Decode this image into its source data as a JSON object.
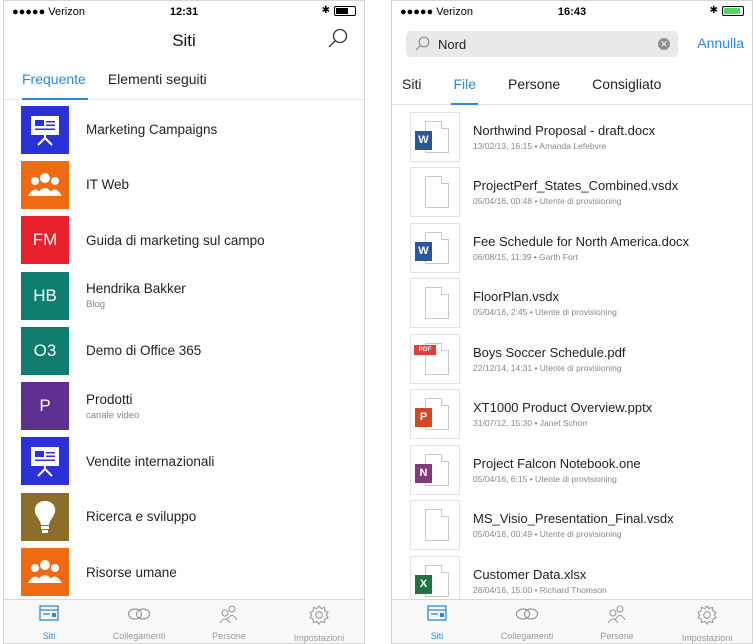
{
  "left": {
    "status": {
      "carrier": "●●●●● Verizon",
      "time": "12:31"
    },
    "title": "Siti",
    "tabs": [
      {
        "label": "Frequente",
        "active": true
      },
      {
        "label": "Elementi seguiti",
        "active": false
      }
    ],
    "sites": [
      {
        "name": "Marketing Campaigns",
        "sub": "",
        "tile_text": "",
        "tile_icon": "presentation-icon",
        "color": "#2b31d6"
      },
      {
        "name": "IT Web",
        "sub": "",
        "tile_text": "",
        "tile_icon": "people-group-icon",
        "color": "#ef6a12"
      },
      {
        "name": "Guida di marketing sul campo",
        "sub": "",
        "tile_text": "FM",
        "tile_icon": "",
        "color": "#e8202c"
      },
      {
        "name": "Hendrika Bakker",
        "sub": "Blog",
        "tile_text": "HB",
        "tile_icon": "",
        "color": "#0f7d6e"
      },
      {
        "name": "Demo di Office 365",
        "sub": "",
        "tile_text": "O3",
        "tile_icon": "",
        "color": "#0f7d6e"
      },
      {
        "name": "Prodotti",
        "sub": "canale video",
        "tile_text": "P",
        "tile_icon": "",
        "color": "#5d2f91"
      },
      {
        "name": "Vendite internazionali",
        "sub": "",
        "tile_text": "",
        "tile_icon": "presentation-icon",
        "color": "#2b31d6"
      },
      {
        "name": "Ricerca e sviluppo",
        "sub": "",
        "tile_text": "",
        "tile_icon": "lightbulb-icon",
        "color": "#8a6e2a"
      },
      {
        "name": "Risorse umane",
        "sub": "",
        "tile_text": "",
        "tile_icon": "people-group-icon",
        "color": "#ef6a12"
      }
    ],
    "tabbar": [
      {
        "label": "Siti",
        "icon": "sites-icon",
        "active": true
      },
      {
        "label": "Collegamenti",
        "icon": "link-icon",
        "active": false
      },
      {
        "label": "Persone",
        "icon": "people-icon",
        "active": false
      },
      {
        "label": "Impostazioni",
        "icon": "gear-icon",
        "active": false
      }
    ]
  },
  "right": {
    "status": {
      "carrier": "●●●●● Verizon",
      "time": "16:43"
    },
    "search": {
      "query": "Nord",
      "cancel": "Annulla"
    },
    "tabs": [
      {
        "label": "Siti",
        "active": false
      },
      {
        "label": "File",
        "active": true
      },
      {
        "label": "Persone",
        "active": false
      },
      {
        "label": "Consigliato",
        "active": false
      }
    ],
    "files": [
      {
        "name": "Northwind Proposal - draft.docx",
        "meta": "13/02/13, 16:15 • Amanda Lefebvre",
        "type": "word"
      },
      {
        "name": "ProjectPerf_States_Combined.vsdx",
        "meta": "05/04/16, 00:48 • Utente di provisioning",
        "type": "blank"
      },
      {
        "name": "Fee Schedule for North America.docx",
        "meta": "06/08/15, 11:39 • Garth Fort",
        "type": "word"
      },
      {
        "name": "FloorPlan.vsdx",
        "meta": "05/04/16, 2:45 • Utente di provisioning",
        "type": "blank"
      },
      {
        "name": "Boys Soccer Schedule.pdf",
        "meta": "22/12/14, 14:31 • Utente di provisioning",
        "type": "pdf"
      },
      {
        "name": "XT1000 Product Overview.pptx",
        "meta": "31/07/12, 15:30 • Janet Schorr",
        "type": "powerpoint"
      },
      {
        "name": "Project Falcon Notebook.one",
        "meta": "05/04/16, 6:15 • Utente di provisioning",
        "type": "onenote"
      },
      {
        "name": "MS_Visio_Presentation_Final.vsdx",
        "meta": "05/04/16, 00:49 • Utente di provisioning",
        "type": "blank"
      },
      {
        "name": "Customer Data.xlsx",
        "meta": "28/04/16, 15:00 • Richard Thomson",
        "type": "excel"
      }
    ],
    "tabbar": [
      {
        "label": "Siti",
        "icon": "sites-icon",
        "active": true
      },
      {
        "label": "Collegamenti",
        "icon": "link-icon",
        "active": false
      },
      {
        "label": "Persone",
        "icon": "people-icon",
        "active": false
      },
      {
        "label": "Impostazioni",
        "icon": "gear-icon",
        "active": false
      }
    ]
  },
  "colors": {
    "accent": "#2b88d8",
    "word": "#2b579a",
    "powerpoint": "#d24726",
    "onenote": "#80397b",
    "excel": "#217346",
    "pdf": "#e13d3d"
  },
  "badges": {
    "word": "W",
    "powerpoint": "P",
    "onenote": "N",
    "excel": "X",
    "pdf": "PDF"
  }
}
